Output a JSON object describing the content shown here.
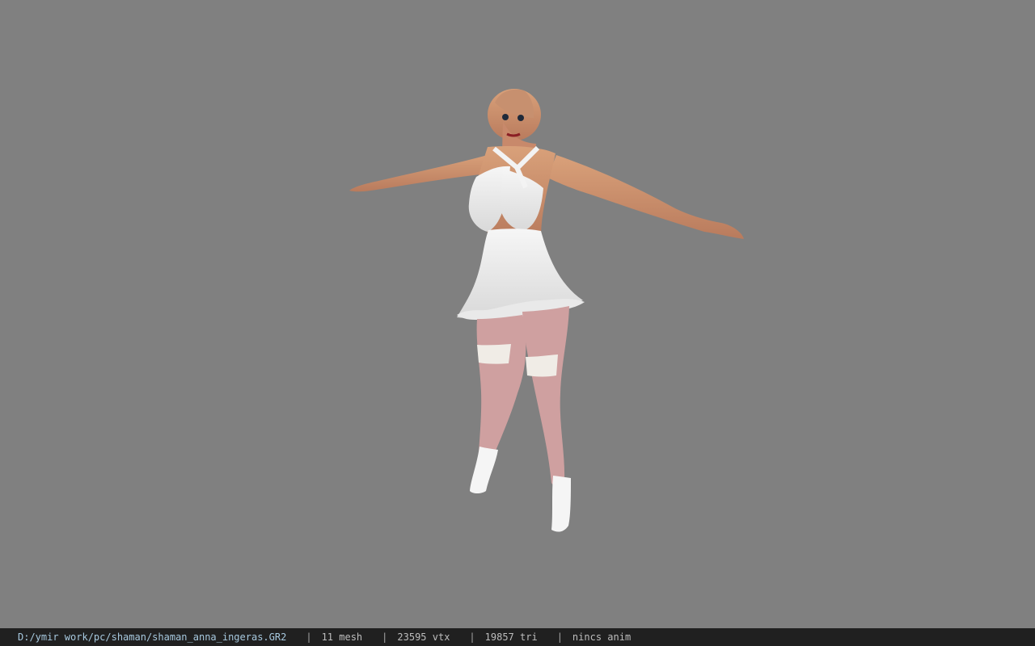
{
  "status_bar": {
    "file_path": "D:/ymir work/pc/shaman/shaman_anna_ingeras.GR2",
    "separator": "|",
    "mesh_count": "11 mesh",
    "vertex_count": "23595 vtx",
    "triangle_count": "19857 tri",
    "animation": "nincs anim"
  },
  "colors": {
    "viewport_background": "#808080",
    "status_bar_background": "#202020",
    "path_text": "#a7c9df",
    "stat_text": "#bdbdbd"
  }
}
